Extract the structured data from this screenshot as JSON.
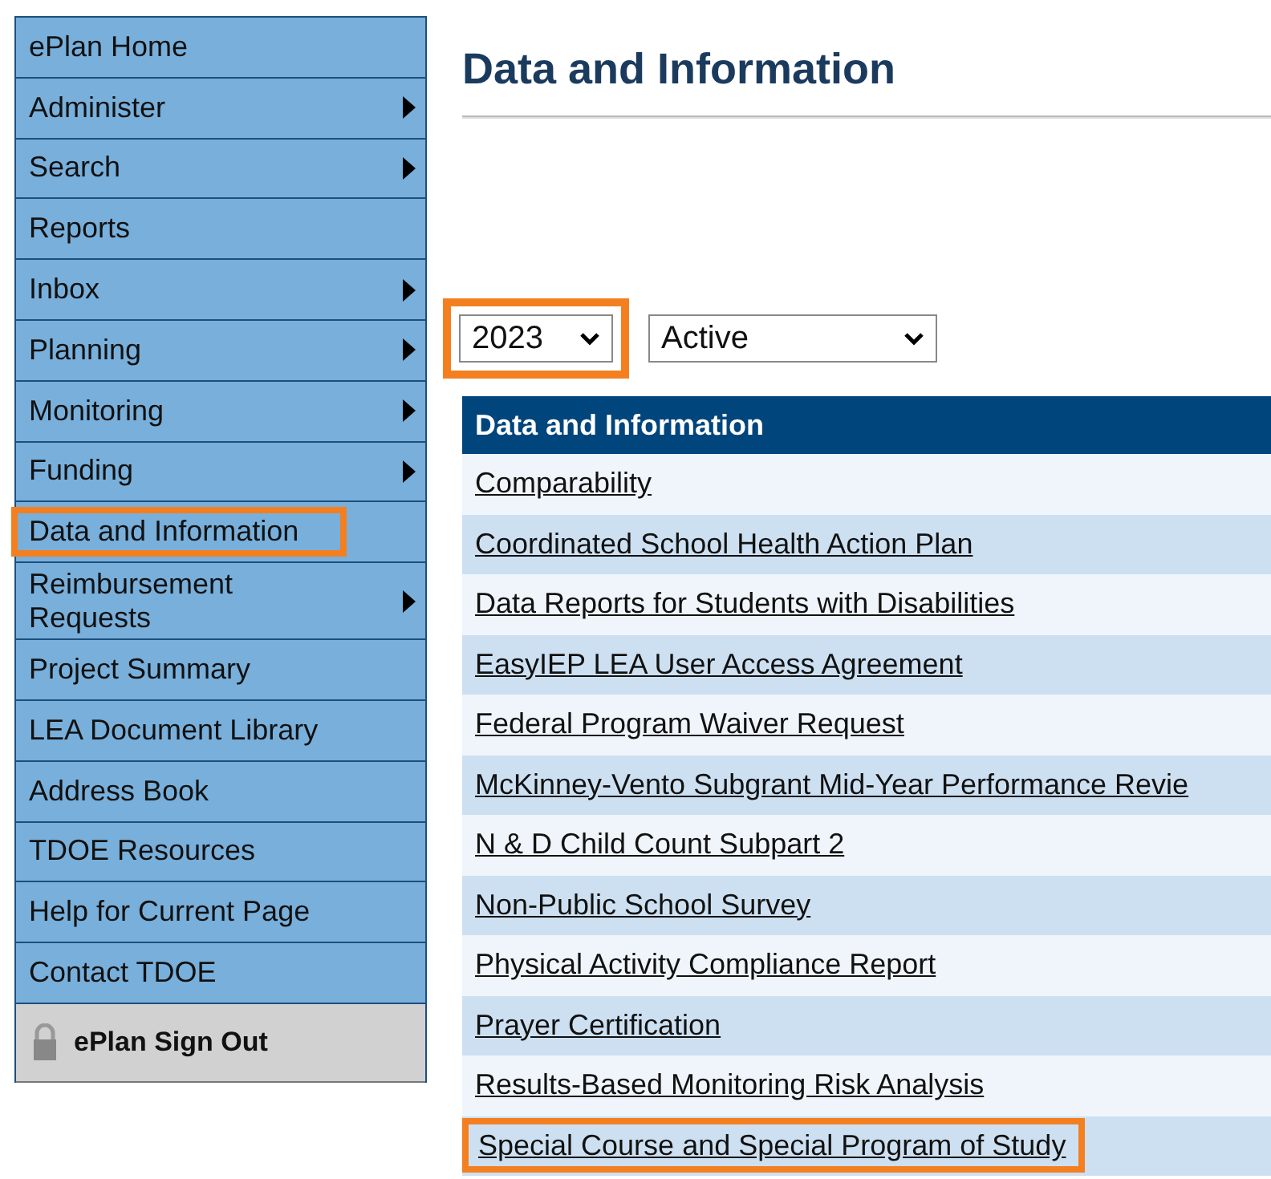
{
  "sidebar": {
    "items": [
      {
        "label": "ePlan Home",
        "submenu": false,
        "highlighted": false
      },
      {
        "label": "Administer",
        "submenu": true,
        "highlighted": false
      },
      {
        "label": "Search",
        "submenu": true,
        "highlighted": false
      },
      {
        "label": "Reports",
        "submenu": false,
        "highlighted": false
      },
      {
        "label": "Inbox",
        "submenu": true,
        "highlighted": false
      },
      {
        "label": "Planning",
        "submenu": true,
        "highlighted": false
      },
      {
        "label": "Monitoring",
        "submenu": true,
        "highlighted": false
      },
      {
        "label": "Funding",
        "submenu": true,
        "highlighted": false
      },
      {
        "label": "Data and Information",
        "submenu": false,
        "highlighted": true
      },
      {
        "label": "Reimbursement Requests",
        "submenu": true,
        "highlighted": false
      },
      {
        "label": "Project Summary",
        "submenu": false,
        "highlighted": false
      },
      {
        "label": "LEA Document Library",
        "submenu": false,
        "highlighted": false
      },
      {
        "label": "Address Book",
        "submenu": false,
        "highlighted": false
      },
      {
        "label": "TDOE Resources",
        "submenu": false,
        "highlighted": false
      },
      {
        "label": "Help for Current Page",
        "submenu": false,
        "highlighted": false
      },
      {
        "label": "Contact TDOE",
        "submenu": false,
        "highlighted": false
      }
    ],
    "sign_out": "ePlan Sign Out"
  },
  "page_title": "Data and Information",
  "filters": [
    {
      "value": "2023",
      "highlighted": true
    },
    {
      "value": "Active",
      "highlighted": false
    }
  ],
  "table": {
    "header": "Data and Information",
    "rows": [
      {
        "label": "Comparability",
        "highlighted": false
      },
      {
        "label": "Coordinated School Health Action Plan",
        "highlighted": false
      },
      {
        "label": "Data Reports for Students with Disabilities",
        "highlighted": false
      },
      {
        "label": "EasyIEP LEA User Access Agreement",
        "highlighted": false
      },
      {
        "label": "Federal Program Waiver Request",
        "highlighted": false
      },
      {
        "label": "McKinney-Vento Subgrant Mid-Year Performance Revie",
        "highlighted": false
      },
      {
        "label": "N & D Child Count Subpart 2",
        "highlighted": false
      },
      {
        "label": "Non-Public School Survey",
        "highlighted": false
      },
      {
        "label": "Physical Activity Compliance Report",
        "highlighted": false
      },
      {
        "label": "Prayer Certification",
        "highlighted": false
      },
      {
        "label": "Results-Based Monitoring Risk Analysis",
        "highlighted": false
      },
      {
        "label": "Special Course and Special Program of Study",
        "highlighted": true
      }
    ]
  }
}
